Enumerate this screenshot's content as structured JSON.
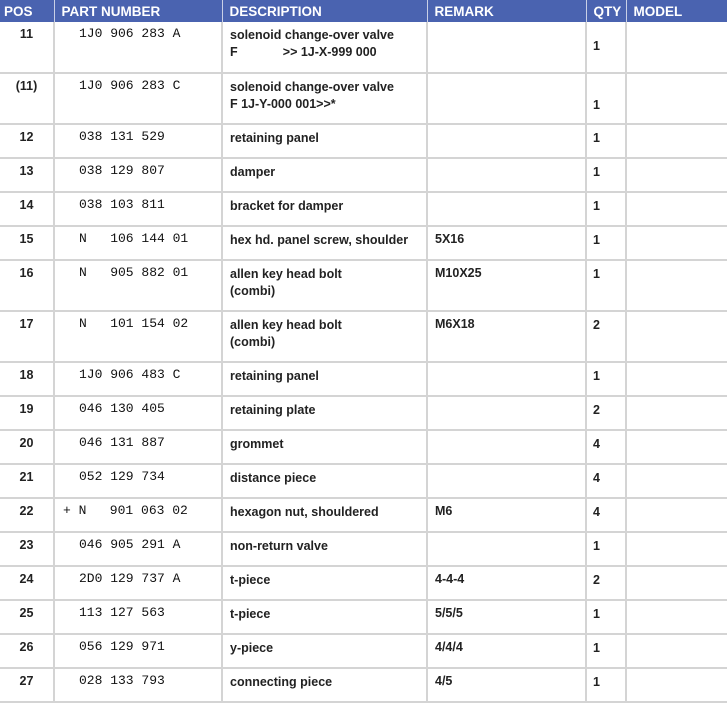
{
  "headers": {
    "pos": "POS",
    "part_number": "PART NUMBER",
    "description": "DESCRIPTION",
    "remark": "REMARK",
    "qty": "QTY",
    "model": "MODEL"
  },
  "rows": [
    {
      "pos": "11",
      "part": "1J0 906 283 A",
      "desc1": "solenoid change-over valve",
      "desc2": "F             >> 1J-X-999 000",
      "remark": "",
      "qty": "1"
    },
    {
      "pos": "(11)",
      "part": "1J0 906 283 C",
      "desc1": "solenoid change-over valve",
      "desc2": "F 1J-Y-000 001>>*",
      "remark": "",
      "qty": "1"
    },
    {
      "pos": "12",
      "part": "038 131 529",
      "desc1": "retaining panel",
      "desc2": "",
      "remark": "",
      "qty": "1"
    },
    {
      "pos": "13",
      "part": "038 129 807",
      "desc1": "damper",
      "desc2": "",
      "remark": "",
      "qty": "1"
    },
    {
      "pos": "14",
      "part": "038 103 811",
      "desc1": "bracket for damper",
      "desc2": "",
      "remark": "",
      "qty": "1"
    },
    {
      "pos": "15",
      "part": "N   106 144 01",
      "desc1": "hex hd. panel screw, shoulder",
      "desc2": "",
      "remark": "5X16",
      "qty": "1"
    },
    {
      "pos": "16",
      "part": "N   905 882 01",
      "desc1": "allen key head bolt",
      "desc2": "(combi)",
      "remark": "M10X25",
      "qty": "1"
    },
    {
      "pos": "17",
      "part": "N   101 154 02",
      "desc1": "allen key head bolt",
      "desc2": "(combi)",
      "remark": "M6X18",
      "qty": "2"
    },
    {
      "pos": "18",
      "part": "1J0 906 483 C",
      "desc1": "retaining panel",
      "desc2": "",
      "remark": "",
      "qty": "1"
    },
    {
      "pos": "19",
      "part": "046 130 405",
      "desc1": "retaining plate",
      "desc2": "",
      "remark": "",
      "qty": "2"
    },
    {
      "pos": "20",
      "part": "046 131 887",
      "desc1": "grommet",
      "desc2": "",
      "remark": "",
      "qty": "4"
    },
    {
      "pos": "21",
      "part": "052 129 734",
      "desc1": "distance piece",
      "desc2": "",
      "remark": "",
      "qty": "4"
    },
    {
      "pos": "22",
      "part": "+ N   901 063 02",
      "desc1": "hexagon nut, shouldered",
      "desc2": "",
      "remark": "M6",
      "qty": "4"
    },
    {
      "pos": "23",
      "part": "046 905 291 A",
      "desc1": "non-return valve",
      "desc2": "",
      "remark": "",
      "qty": "1"
    },
    {
      "pos": "24",
      "part": "2D0 129 737 A",
      "desc1": "t-piece",
      "desc2": "",
      "remark": "4-4-4",
      "qty": "2"
    },
    {
      "pos": "25",
      "part": "113 127 563",
      "desc1": "t-piece",
      "desc2": "",
      "remark": "5/5/5",
      "qty": "1"
    },
    {
      "pos": "26",
      "part": "056 129 971",
      "desc1": "y-piece",
      "desc2": "",
      "remark": "4/4/4",
      "qty": "1"
    },
    {
      "pos": "27",
      "part": "028 133 793",
      "desc1": "connecting piece",
      "desc2": "",
      "remark": "4/5",
      "qty": "1"
    }
  ]
}
